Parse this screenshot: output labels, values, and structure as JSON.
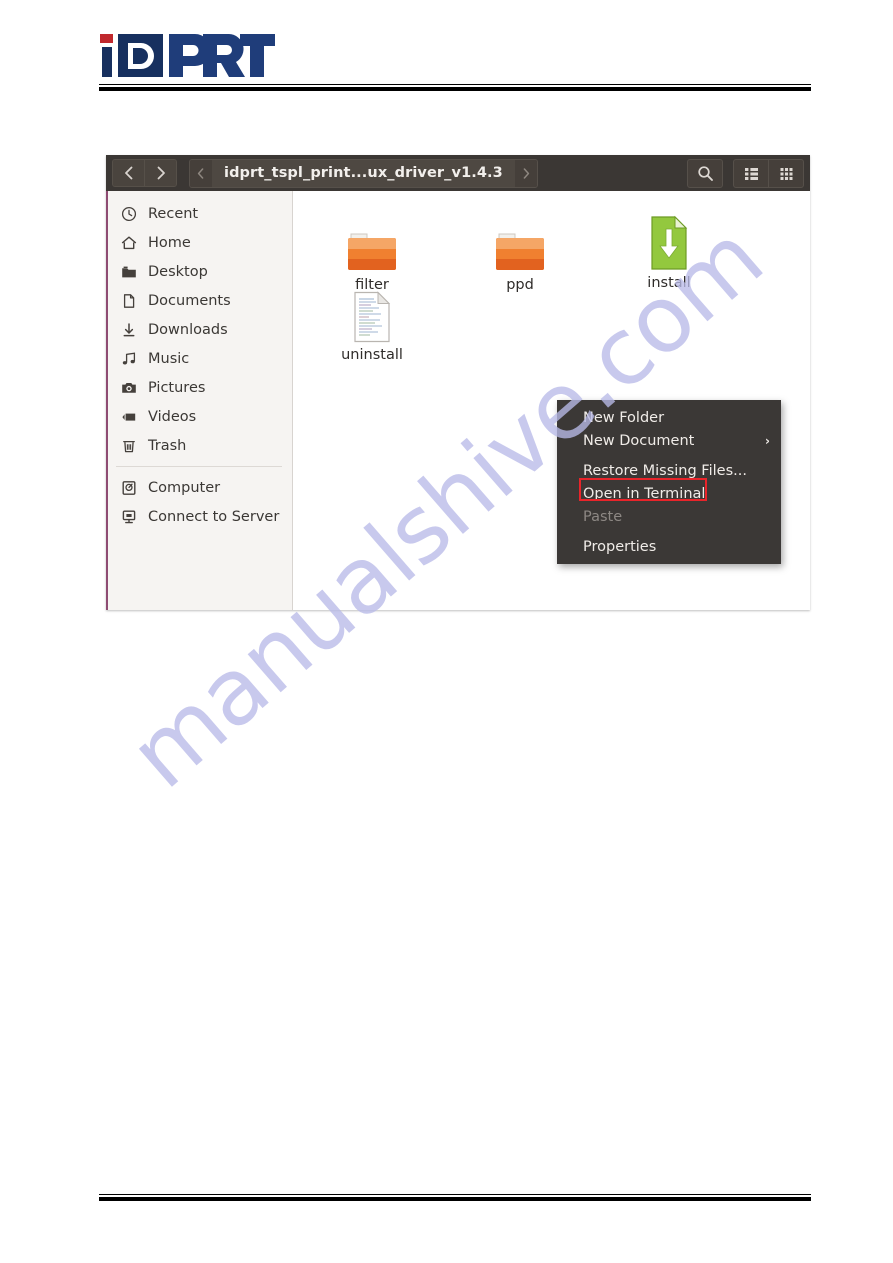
{
  "brand": {
    "name": "iDPRT",
    "logo_colors": {
      "blue": "#1f3d7a",
      "dark_blue": "#17305f",
      "red": "#c0282d"
    }
  },
  "file_manager": {
    "headerbar": {
      "back_icon": "chevron-left-icon",
      "forward_icon": "chevron-right-icon",
      "path_prev_icon": "chevron-left-icon",
      "path_next_icon": "chevron-right-icon",
      "current_path": "idprt_tspl_print...ux_driver_v1.4.3",
      "search_icon": "search-icon",
      "list_view_icon": "list-view-icon",
      "grid_view_icon": "grid-view-icon",
      "background": "#3b3734"
    },
    "sidebar": {
      "background": "#f6f4f2",
      "accent_color": "#8e4b72",
      "groups": [
        {
          "items": [
            {
              "label": "Recent",
              "icon": "clock-icon"
            },
            {
              "label": "Home",
              "icon": "home-icon"
            },
            {
              "label": "Desktop",
              "icon": "desktop-folder-icon"
            },
            {
              "label": "Documents",
              "icon": "document-icon"
            },
            {
              "label": "Downloads",
              "icon": "download-icon"
            },
            {
              "label": "Music",
              "icon": "music-note-icon"
            },
            {
              "label": "Pictures",
              "icon": "camera-icon"
            },
            {
              "label": "Videos",
              "icon": "video-icon"
            },
            {
              "label": "Trash",
              "icon": "trash-icon"
            }
          ]
        },
        {
          "items": [
            {
              "label": "Computer",
              "icon": "computer-disk-icon"
            },
            {
              "label": "Connect to Server",
              "icon": "server-icon"
            }
          ]
        }
      ]
    },
    "files": [
      {
        "label": "filter",
        "type": "folder",
        "color": "#ef7033"
      },
      {
        "label": "ppd",
        "type": "folder",
        "color": "#ef7033"
      },
      {
        "label": "install",
        "type": "script",
        "color": "#8dc63f"
      },
      {
        "label": "uninstall",
        "type": "text-document",
        "color": "#ffffff"
      }
    ]
  },
  "context_menu": {
    "background": "#3b3836",
    "highlight_color": "#e8242a",
    "items": [
      {
        "label": "New Folder",
        "disabled": false,
        "submenu": false
      },
      {
        "label": "New Document",
        "disabled": false,
        "submenu": true
      },
      {
        "label": "Restore Missing Files...",
        "disabled": false,
        "submenu": false
      },
      {
        "label": "Open in Terminal",
        "disabled": false,
        "submenu": false,
        "highlighted": true
      },
      {
        "label": "Paste",
        "disabled": true,
        "submenu": false
      },
      {
        "label": "Properties",
        "disabled": false,
        "submenu": false
      }
    ]
  },
  "watermark": {
    "text": "manualshive.com",
    "color": "#b9bbe8"
  }
}
